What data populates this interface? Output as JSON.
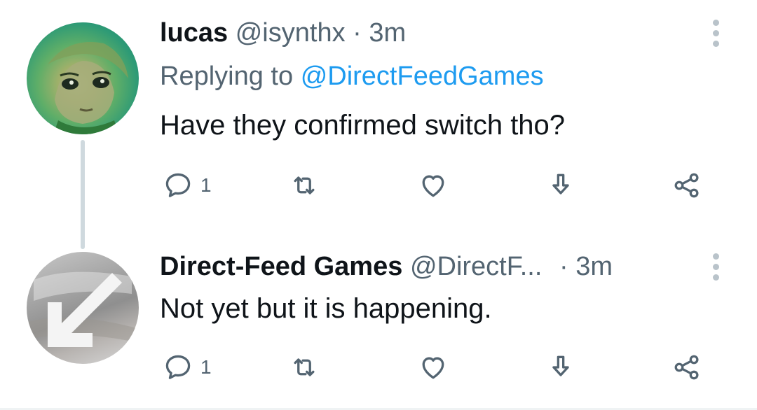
{
  "tweets": [
    {
      "display_name": "lucas",
      "handle": "@isynthx",
      "separator": "·",
      "time": "3m",
      "reply_prefix": "Replying to",
      "reply_mention": "@DirectFeedGames",
      "text": "Have they confirmed switch tho?",
      "reply_count": "1",
      "avatar": "cartoon-character-avatar"
    },
    {
      "display_name": "Direct-Feed Games",
      "handle": "@DirectF...",
      "separator": "·",
      "time": "3m",
      "text": "Not yet but it is happening.",
      "reply_count": "1",
      "avatar": "arrow-logo-avatar"
    }
  ],
  "icons": [
    "reply-icon",
    "retweet-icon",
    "like-icon",
    "save-icon",
    "share-icon",
    "more-icon"
  ],
  "colors": {
    "text": "#0f1419",
    "secondary": "#536471",
    "mention": "#1d9bf0",
    "thread_line": "#cfd9de"
  }
}
